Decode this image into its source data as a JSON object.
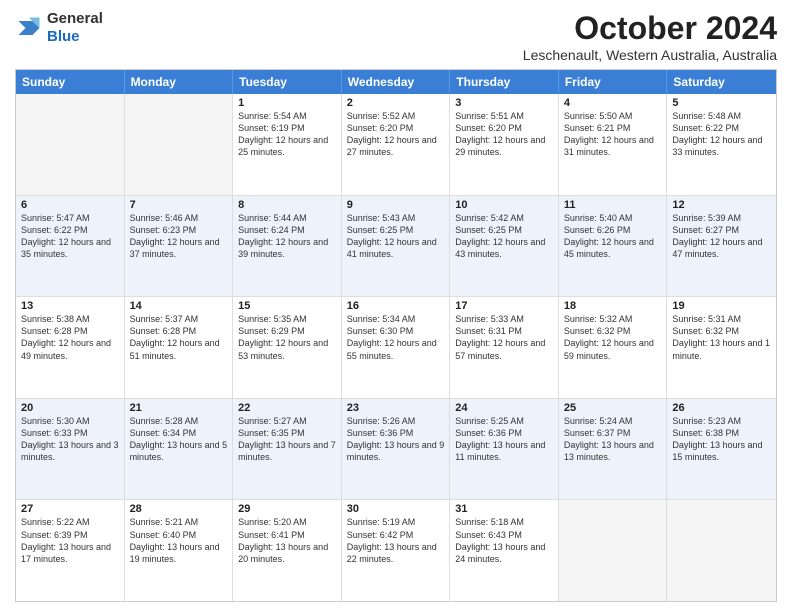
{
  "logo": {
    "line1": "General",
    "line2": "Blue"
  },
  "title": "October 2024",
  "subtitle": "Leschenault, Western Australia, Australia",
  "days_of_week": [
    "Sunday",
    "Monday",
    "Tuesday",
    "Wednesday",
    "Thursday",
    "Friday",
    "Saturday"
  ],
  "weeks": [
    [
      {
        "day": "",
        "sunrise": "",
        "sunset": "",
        "daylight": "",
        "empty": true
      },
      {
        "day": "",
        "sunrise": "",
        "sunset": "",
        "daylight": "",
        "empty": true
      },
      {
        "day": "1",
        "sunrise": "Sunrise: 5:54 AM",
        "sunset": "Sunset: 6:19 PM",
        "daylight": "Daylight: 12 hours and 25 minutes.",
        "empty": false
      },
      {
        "day": "2",
        "sunrise": "Sunrise: 5:52 AM",
        "sunset": "Sunset: 6:20 PM",
        "daylight": "Daylight: 12 hours and 27 minutes.",
        "empty": false
      },
      {
        "day": "3",
        "sunrise": "Sunrise: 5:51 AM",
        "sunset": "Sunset: 6:20 PM",
        "daylight": "Daylight: 12 hours and 29 minutes.",
        "empty": false
      },
      {
        "day": "4",
        "sunrise": "Sunrise: 5:50 AM",
        "sunset": "Sunset: 6:21 PM",
        "daylight": "Daylight: 12 hours and 31 minutes.",
        "empty": false
      },
      {
        "day": "5",
        "sunrise": "Sunrise: 5:48 AM",
        "sunset": "Sunset: 6:22 PM",
        "daylight": "Daylight: 12 hours and 33 minutes.",
        "empty": false
      }
    ],
    [
      {
        "day": "6",
        "sunrise": "Sunrise: 5:47 AM",
        "sunset": "Sunset: 6:22 PM",
        "daylight": "Daylight: 12 hours and 35 minutes.",
        "empty": false
      },
      {
        "day": "7",
        "sunrise": "Sunrise: 5:46 AM",
        "sunset": "Sunset: 6:23 PM",
        "daylight": "Daylight: 12 hours and 37 minutes.",
        "empty": false
      },
      {
        "day": "8",
        "sunrise": "Sunrise: 5:44 AM",
        "sunset": "Sunset: 6:24 PM",
        "daylight": "Daylight: 12 hours and 39 minutes.",
        "empty": false
      },
      {
        "day": "9",
        "sunrise": "Sunrise: 5:43 AM",
        "sunset": "Sunset: 6:25 PM",
        "daylight": "Daylight: 12 hours and 41 minutes.",
        "empty": false
      },
      {
        "day": "10",
        "sunrise": "Sunrise: 5:42 AM",
        "sunset": "Sunset: 6:25 PM",
        "daylight": "Daylight: 12 hours and 43 minutes.",
        "empty": false
      },
      {
        "day": "11",
        "sunrise": "Sunrise: 5:40 AM",
        "sunset": "Sunset: 6:26 PM",
        "daylight": "Daylight: 12 hours and 45 minutes.",
        "empty": false
      },
      {
        "day": "12",
        "sunrise": "Sunrise: 5:39 AM",
        "sunset": "Sunset: 6:27 PM",
        "daylight": "Daylight: 12 hours and 47 minutes.",
        "empty": false
      }
    ],
    [
      {
        "day": "13",
        "sunrise": "Sunrise: 5:38 AM",
        "sunset": "Sunset: 6:28 PM",
        "daylight": "Daylight: 12 hours and 49 minutes.",
        "empty": false
      },
      {
        "day": "14",
        "sunrise": "Sunrise: 5:37 AM",
        "sunset": "Sunset: 6:28 PM",
        "daylight": "Daylight: 12 hours and 51 minutes.",
        "empty": false
      },
      {
        "day": "15",
        "sunrise": "Sunrise: 5:35 AM",
        "sunset": "Sunset: 6:29 PM",
        "daylight": "Daylight: 12 hours and 53 minutes.",
        "empty": false
      },
      {
        "day": "16",
        "sunrise": "Sunrise: 5:34 AM",
        "sunset": "Sunset: 6:30 PM",
        "daylight": "Daylight: 12 hours and 55 minutes.",
        "empty": false
      },
      {
        "day": "17",
        "sunrise": "Sunrise: 5:33 AM",
        "sunset": "Sunset: 6:31 PM",
        "daylight": "Daylight: 12 hours and 57 minutes.",
        "empty": false
      },
      {
        "day": "18",
        "sunrise": "Sunrise: 5:32 AM",
        "sunset": "Sunset: 6:32 PM",
        "daylight": "Daylight: 12 hours and 59 minutes.",
        "empty": false
      },
      {
        "day": "19",
        "sunrise": "Sunrise: 5:31 AM",
        "sunset": "Sunset: 6:32 PM",
        "daylight": "Daylight: 13 hours and 1 minute.",
        "empty": false
      }
    ],
    [
      {
        "day": "20",
        "sunrise": "Sunrise: 5:30 AM",
        "sunset": "Sunset: 6:33 PM",
        "daylight": "Daylight: 13 hours and 3 minutes.",
        "empty": false
      },
      {
        "day": "21",
        "sunrise": "Sunrise: 5:28 AM",
        "sunset": "Sunset: 6:34 PM",
        "daylight": "Daylight: 13 hours and 5 minutes.",
        "empty": false
      },
      {
        "day": "22",
        "sunrise": "Sunrise: 5:27 AM",
        "sunset": "Sunset: 6:35 PM",
        "daylight": "Daylight: 13 hours and 7 minutes.",
        "empty": false
      },
      {
        "day": "23",
        "sunrise": "Sunrise: 5:26 AM",
        "sunset": "Sunset: 6:36 PM",
        "daylight": "Daylight: 13 hours and 9 minutes.",
        "empty": false
      },
      {
        "day": "24",
        "sunrise": "Sunrise: 5:25 AM",
        "sunset": "Sunset: 6:36 PM",
        "daylight": "Daylight: 13 hours and 11 minutes.",
        "empty": false
      },
      {
        "day": "25",
        "sunrise": "Sunrise: 5:24 AM",
        "sunset": "Sunset: 6:37 PM",
        "daylight": "Daylight: 13 hours and 13 minutes.",
        "empty": false
      },
      {
        "day": "26",
        "sunrise": "Sunrise: 5:23 AM",
        "sunset": "Sunset: 6:38 PM",
        "daylight": "Daylight: 13 hours and 15 minutes.",
        "empty": false
      }
    ],
    [
      {
        "day": "27",
        "sunrise": "Sunrise: 5:22 AM",
        "sunset": "Sunset: 6:39 PM",
        "daylight": "Daylight: 13 hours and 17 minutes.",
        "empty": false
      },
      {
        "day": "28",
        "sunrise": "Sunrise: 5:21 AM",
        "sunset": "Sunset: 6:40 PM",
        "daylight": "Daylight: 13 hours and 19 minutes.",
        "empty": false
      },
      {
        "day": "29",
        "sunrise": "Sunrise: 5:20 AM",
        "sunset": "Sunset: 6:41 PM",
        "daylight": "Daylight: 13 hours and 20 minutes.",
        "empty": false
      },
      {
        "day": "30",
        "sunrise": "Sunrise: 5:19 AM",
        "sunset": "Sunset: 6:42 PM",
        "daylight": "Daylight: 13 hours and 22 minutes.",
        "empty": false
      },
      {
        "day": "31",
        "sunrise": "Sunrise: 5:18 AM",
        "sunset": "Sunset: 6:43 PM",
        "daylight": "Daylight: 13 hours and 24 minutes.",
        "empty": false
      },
      {
        "day": "",
        "sunrise": "",
        "sunset": "",
        "daylight": "",
        "empty": true
      },
      {
        "day": "",
        "sunrise": "",
        "sunset": "",
        "daylight": "",
        "empty": true
      }
    ]
  ]
}
